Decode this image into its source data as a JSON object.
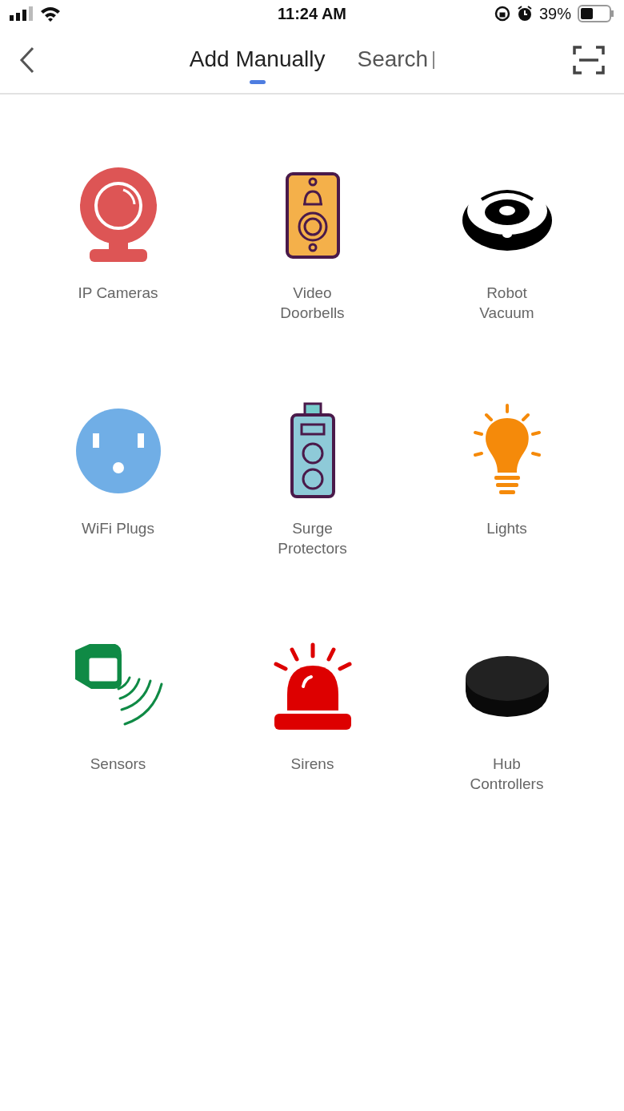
{
  "status_bar": {
    "time": "11:24 AM",
    "battery": "39%"
  },
  "tabs": [
    {
      "label": "Add Manually",
      "selected": true
    },
    {
      "label": "Search",
      "selected": false
    }
  ],
  "categories": [
    {
      "kind": "camera",
      "label": "IP Cameras"
    },
    {
      "kind": "doorbell",
      "label": "Video\nDoorbells"
    },
    {
      "kind": "vacuum",
      "label": "Robot\nVacuum"
    },
    {
      "kind": "plug",
      "label": "WiFi Plugs"
    },
    {
      "kind": "surge",
      "label": "Surge\nProtectors"
    },
    {
      "kind": "bulb",
      "label": "Lights"
    },
    {
      "kind": "sensor",
      "label": "Sensors"
    },
    {
      "kind": "siren",
      "label": "Sirens"
    },
    {
      "kind": "hub",
      "label": "Hub\nControllers"
    }
  ]
}
